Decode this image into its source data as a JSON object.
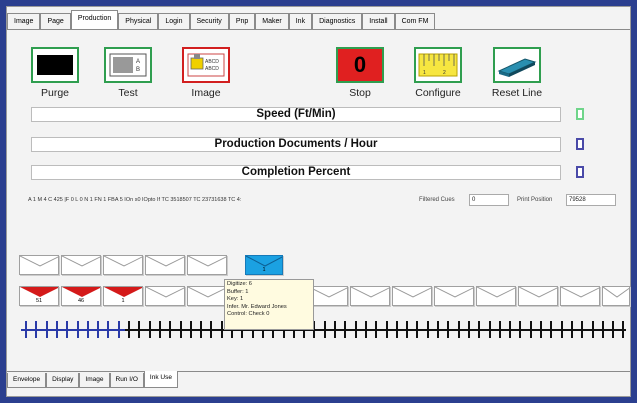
{
  "top_tabs": [
    "Image",
    "Page",
    "Production",
    "Physical",
    "Login",
    "Security",
    "Pnp",
    "Maker",
    "Ink",
    "Diagnostics",
    "Install",
    "Com FM"
  ],
  "active_top_tab": "Production",
  "toolbar": {
    "purge": "Purge",
    "test": "Test",
    "image": "Image",
    "stop": "Stop",
    "stop_value": "0",
    "configure": "Configure",
    "reset_line": "Reset Line",
    "test_icon_text": "A\nB",
    "image_icon_text": "ABCD\nABCD",
    "ruler_text": "1 2"
  },
  "stats": {
    "speed": "Speed (Ft/Min)",
    "production": "Production Documents / Hour",
    "completion": "Completion Percent"
  },
  "indicator_colors": [
    "#6fd58a",
    "#4a4aa8",
    "#4a4aa8"
  ],
  "info_line": "A 1 M 4 C 425 |F 0 L 0 N 1 FN 1 FBA 5 IOn s0 IOpto If TC 3518507 TC 23731638 TC 4:",
  "filtered_cues": {
    "label": "Filtered Cues",
    "value": "0"
  },
  "print_position": {
    "label": "Print Position",
    "value": "79528"
  },
  "envelopes": {
    "upper_count": 5,
    "selected_label": "1",
    "lower_counts": [
      "51",
      "46",
      "1"
    ]
  },
  "tooltip": [
    "Digitize: 6",
    "Buffer: 1",
    "Key: 1",
    "Infer. Mr. Edward Jones",
    "Control: Check 0"
  ],
  "bottom_tabs": [
    "Envelope",
    "Display",
    "Image",
    "Run I/O",
    "Ink Use"
  ],
  "active_bottom_tab": "Ink Use"
}
